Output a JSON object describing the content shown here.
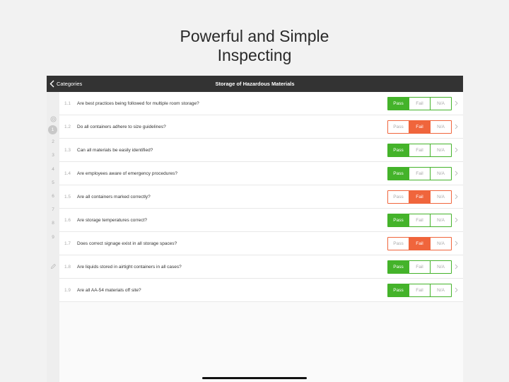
{
  "headline": {
    "line1": "Powerful and Simple",
    "line2": "Inspecting"
  },
  "navbar": {
    "back_label": "Categories",
    "title": "Storage of Hazardous Materials"
  },
  "rail": {
    "items": [
      "1",
      "2",
      "3",
      "4",
      "5",
      "6",
      "7",
      "8",
      "9"
    ],
    "selected": "1"
  },
  "options": {
    "pass": "Pass",
    "fail": "Fail",
    "na": "N/A"
  },
  "colors": {
    "pass": "#44b32a",
    "fail": "#f0653c",
    "navbar": "#333333"
  },
  "questions": [
    {
      "num": "1.1",
      "text": "Are best practices being followed for multiple room storage?",
      "result": "Pass"
    },
    {
      "num": "1.2",
      "text": "Do all containers adhere to size guidelines?",
      "result": "Fail"
    },
    {
      "num": "1.3",
      "text": "Can all materials be easily identified?",
      "result": "Pass"
    },
    {
      "num": "1.4",
      "text": "Are employees aware of emergency procedures?",
      "result": "Pass"
    },
    {
      "num": "1.5",
      "text": "Are all containers marked correctly?",
      "result": "Fail"
    },
    {
      "num": "1.6",
      "text": "Are storage temperatures correct?",
      "result": "Pass"
    },
    {
      "num": "1.7",
      "text": "Does correct signage exist in all storage spaces?",
      "result": "Fail"
    },
    {
      "num": "1.8",
      "text": "Are liquids stored in airtight containers in all cases?",
      "result": "Pass"
    },
    {
      "num": "1.9",
      "text": "Are all AA-54 materials off site?",
      "result": "Pass"
    }
  ]
}
